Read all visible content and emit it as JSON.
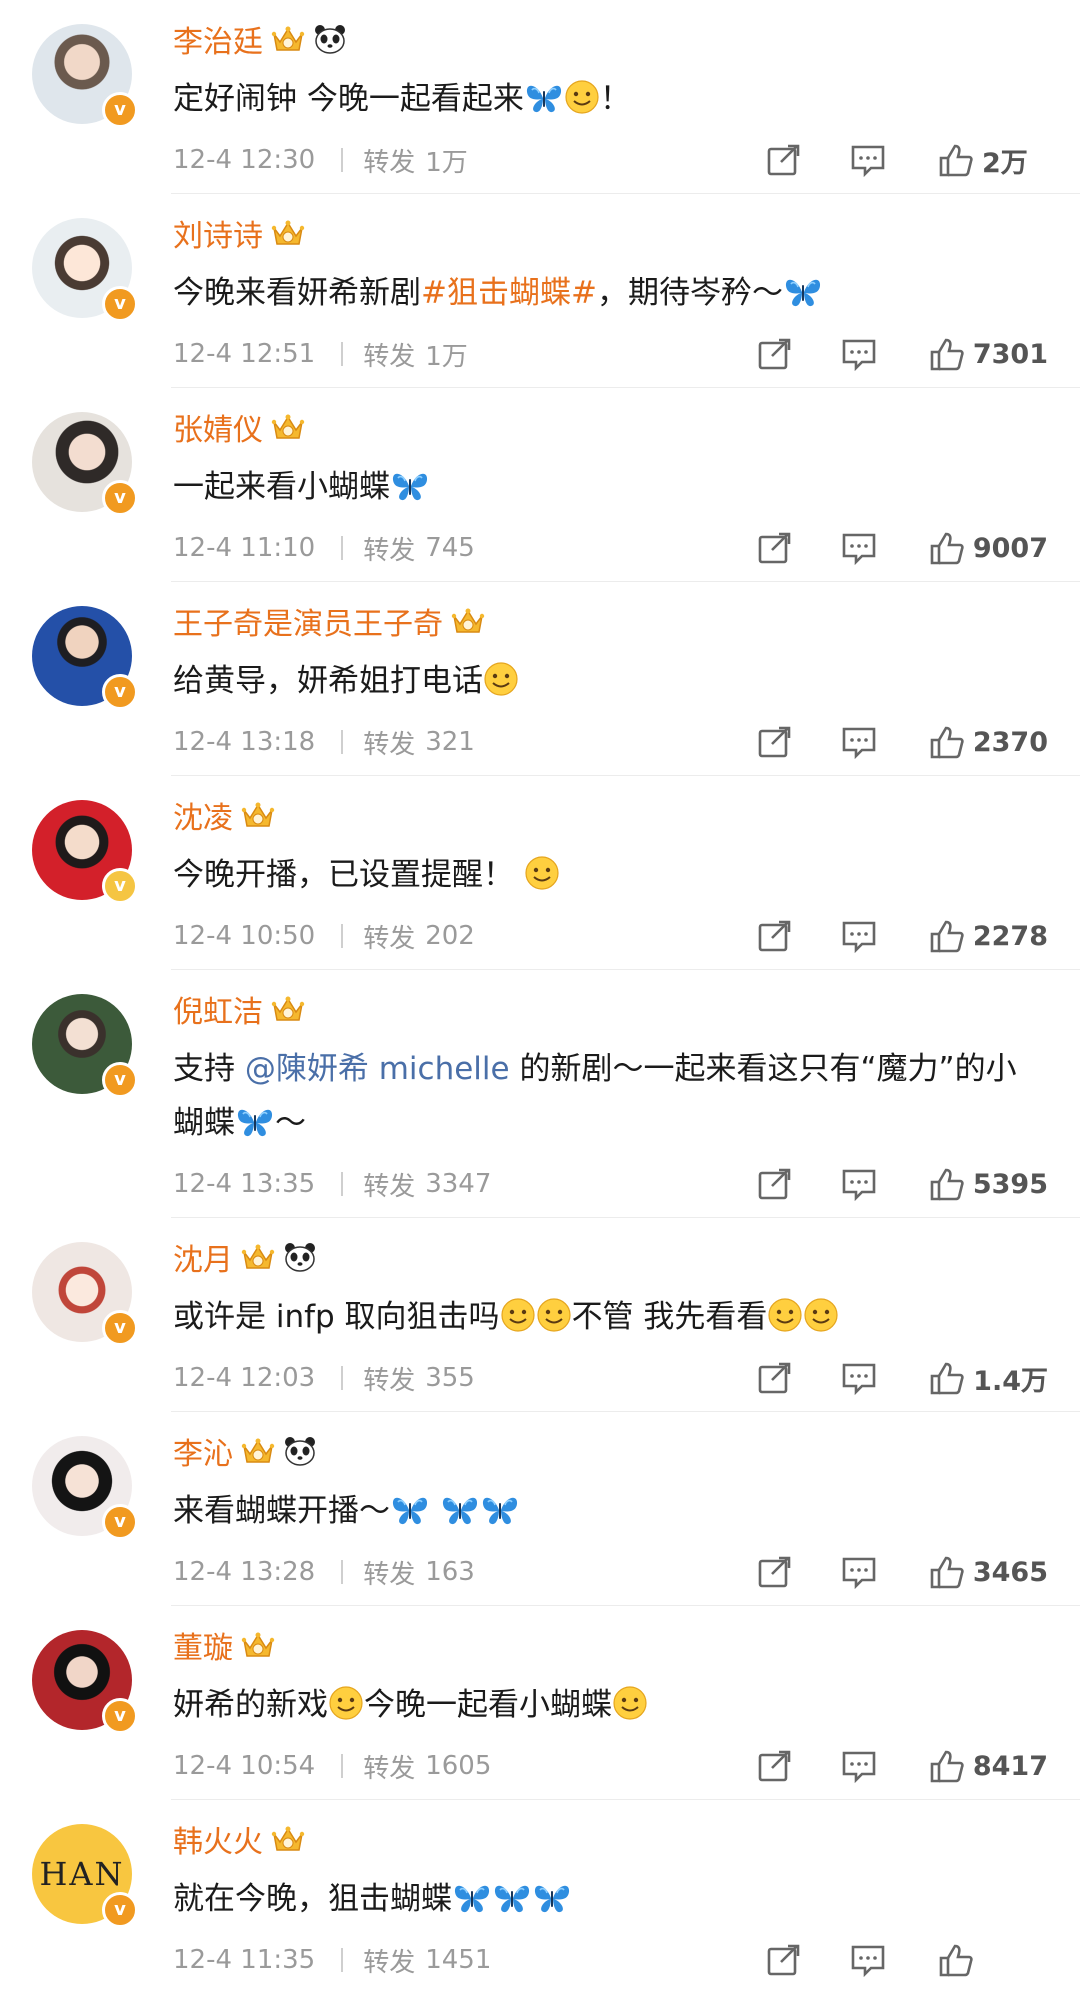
{
  "colors": {
    "name": "#e8711c",
    "mention": "#4a6fa8",
    "meta": "#9a9a9a",
    "badge": "#f19a20"
  },
  "labels": {
    "forward": "转发"
  },
  "posts": [
    {
      "name": "李治廷",
      "panda": true,
      "text_a": "定好闹钟 今晚一起看起来",
      "text_b": "！",
      "time": "12-4 12:30",
      "reposts": "1万",
      "likes": "2万"
    },
    {
      "name": "刘诗诗",
      "panda": false,
      "text_a": "今晚来看妍希新剧",
      "tag": "#狙击蝴蝶#",
      "text_b": "，期待岑矜～",
      "time": "12-4 12:51",
      "reposts": "1万",
      "likes": "7301"
    },
    {
      "name": "张婧仪",
      "panda": false,
      "text_a": "一起来看小蝴蝶",
      "time": "12-4 11:10",
      "reposts": "745",
      "likes": "9007"
    },
    {
      "name": "王子奇是演员王子奇",
      "panda": false,
      "text_a": "给黄导，妍希姐打电话",
      "time": "12-4 13:18",
      "reposts": "321",
      "likes": "2370"
    },
    {
      "name": "沈凌",
      "panda": false,
      "text_a": "今晚开播，已设置提醒！",
      "time": "12-4 10:50",
      "reposts": "202",
      "likes": "2278"
    },
    {
      "name": "倪虹洁",
      "panda": false,
      "text_a": "支持",
      "mention": "@陳妍希 michelle",
      "text_b": "的新剧～一起来看这只有“魔力”的小蝴蝶",
      "text_c": "～",
      "time": "12-4 13:35",
      "reposts": "3347",
      "likes": "5395"
    },
    {
      "name": "沈月",
      "panda": true,
      "text_a": "或许是 infp 取向狙击吗",
      "text_b": "不管 我先看看",
      "time": "12-4 12:03",
      "reposts": "355",
      "likes": "1.4万"
    },
    {
      "name": "李沁",
      "panda": true,
      "text_a": "来看蝴蝶开播～",
      "time": "12-4 13:28",
      "reposts": "163",
      "likes": "3465"
    },
    {
      "name": "董璇",
      "panda": false,
      "text_a": "妍希的新戏",
      "text_b": "今晚一起看小蝴蝶",
      "time": "12-4 10:54",
      "reposts": "1605",
      "likes": "8417"
    },
    {
      "name": "韩火火",
      "panda": false,
      "text_a": "就在今晚，狙击蝴蝶",
      "time": "12-4 11:35",
      "reposts": "1451",
      "likes": ""
    }
  ]
}
